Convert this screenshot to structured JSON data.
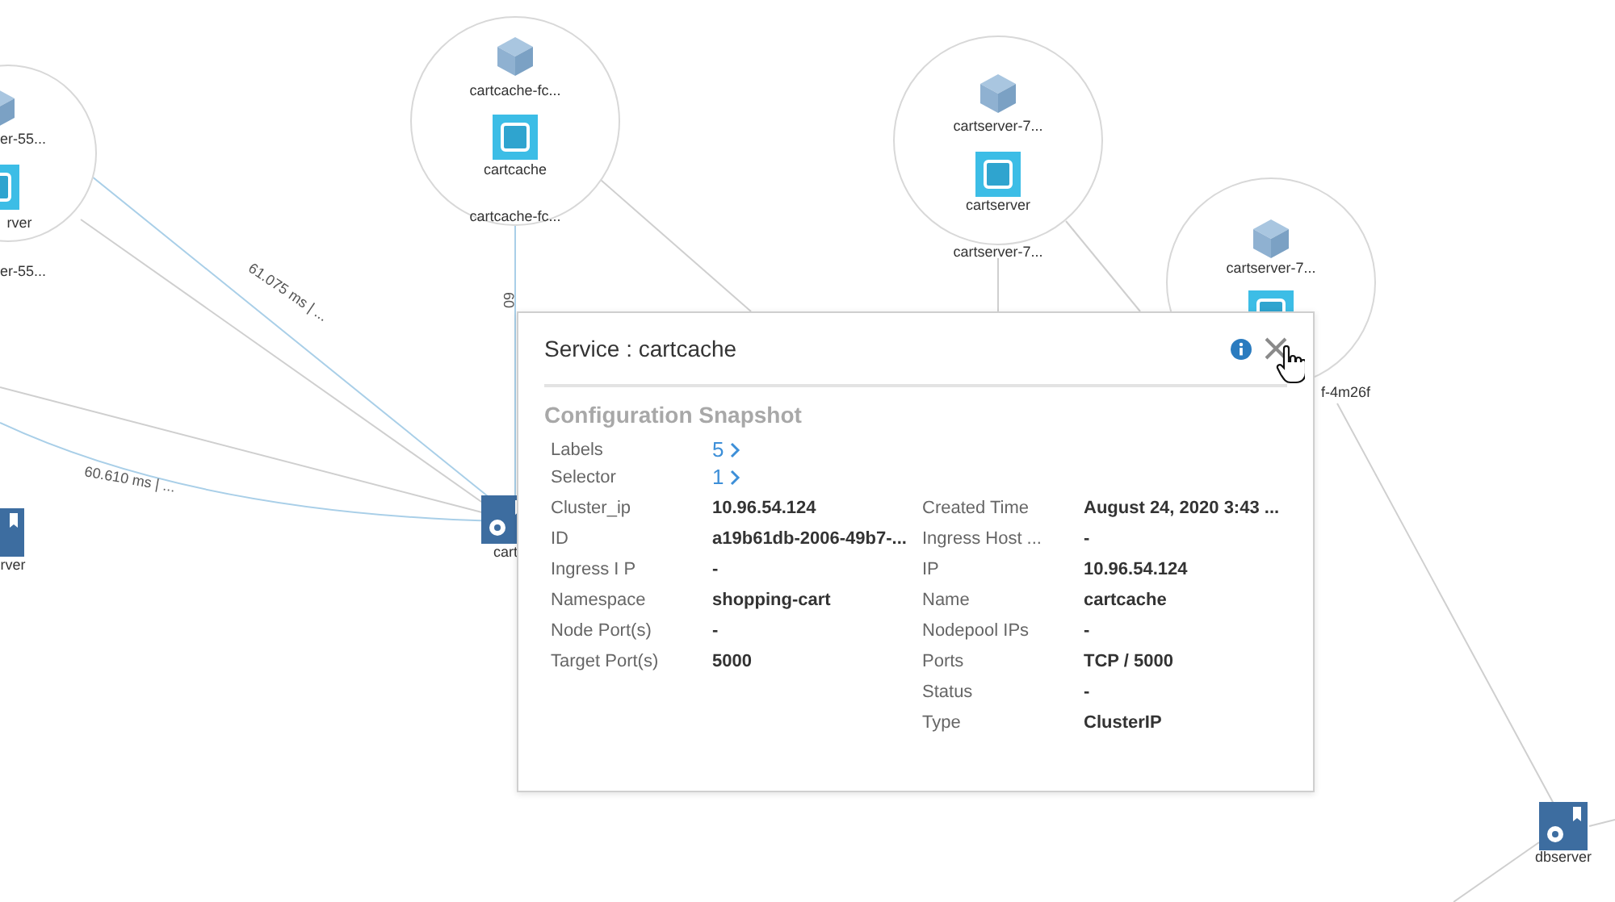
{
  "graph": {
    "clusters": [
      {
        "pod_label": "er-55...",
        "service_label": "rver",
        "node_label": "er-55..."
      },
      {
        "pod_label": "cartcache-fc...",
        "service_label": "cartcache",
        "node_label": "cartcache-fc..."
      },
      {
        "pod_label": "cartserver-7...",
        "service_label": "cartserver",
        "node_label": "cartserver-7..."
      },
      {
        "pod_label": "cartserver-7...",
        "node_label": "f-4m26f"
      }
    ],
    "nodes": [
      {
        "label": "rver"
      },
      {
        "label": "cart"
      },
      {
        "label": "dbserver"
      }
    ],
    "edge_labels": [
      "61.075 ms | ...",
      "60.610 ms | ...",
      "60"
    ]
  },
  "popup": {
    "title": "Service : cartcache",
    "section": "Configuration Snapshot",
    "links": [
      {
        "label": "Labels",
        "count": "5"
      },
      {
        "label": "Selector",
        "count": "1"
      }
    ],
    "fields_left": [
      {
        "label": "Cluster_ip",
        "value": "10.96.54.124"
      },
      {
        "label": "ID",
        "value": "a19b61db-2006-49b7-..."
      },
      {
        "label": "Ingress I P",
        "value": "-"
      },
      {
        "label": "Namespace",
        "value": "shopping-cart"
      },
      {
        "label": "Node Port(s)",
        "value": "-"
      },
      {
        "label": "Target Port(s)",
        "value": "5000"
      }
    ],
    "fields_right": [
      {
        "label": "Created Time",
        "value": "August 24, 2020 3:43 ..."
      },
      {
        "label": "Ingress Host ...",
        "value": "-"
      },
      {
        "label": "IP",
        "value": "10.96.54.124"
      },
      {
        "label": "Name",
        "value": "cartcache"
      },
      {
        "label": "Nodepool IPs",
        "value": "-"
      },
      {
        "label": "Ports",
        "value": "TCP / 5000"
      },
      {
        "label": "Status",
        "value": "-"
      },
      {
        "label": "Type",
        "value": "ClusterIP"
      }
    ]
  }
}
